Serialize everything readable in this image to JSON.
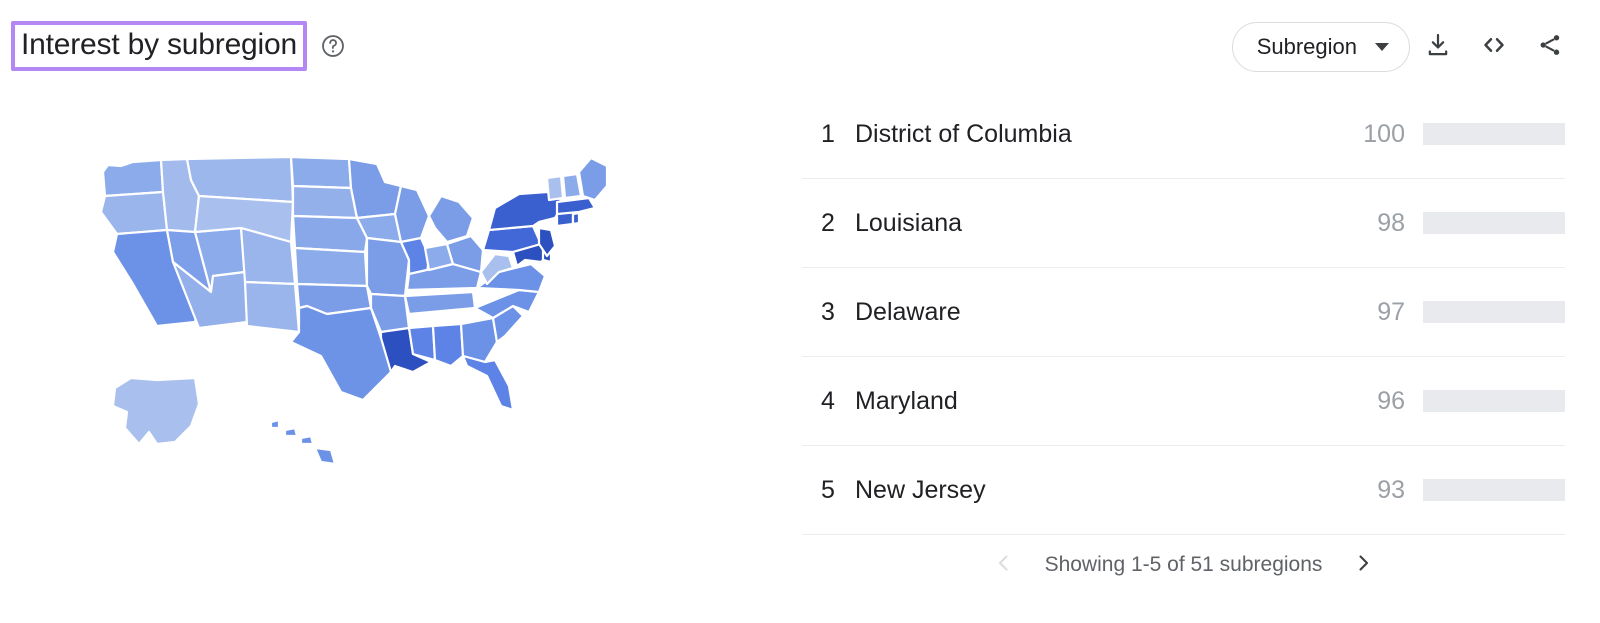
{
  "header": {
    "title": "Interest by subregion",
    "help_icon": "help-circle-icon",
    "title_highlight_color": "#b388f4"
  },
  "toolbar": {
    "region_select_value": "Subregion",
    "caret_icon": "chevron-down-icon",
    "download_icon": "download-icon",
    "embed_icon": "embed-code-icon",
    "share_icon": "share-icon"
  },
  "map": {
    "type": "choropleth",
    "region": "United States",
    "low_color": "#aac1ec",
    "high_color": "#2c50bf",
    "border_color": "#ffffff"
  },
  "list": {
    "bar_color": "#5c87e8",
    "track_color": "#e8eaed",
    "max_value": 100,
    "rows": [
      {
        "rank": "1",
        "name": "District of Columbia",
        "value": "100"
      },
      {
        "rank": "2",
        "name": "Louisiana",
        "value": "98"
      },
      {
        "rank": "3",
        "name": "Delaware",
        "value": "97"
      },
      {
        "rank": "4",
        "name": "Maryland",
        "value": "96"
      },
      {
        "rank": "5",
        "name": "New Jersey",
        "value": "93"
      }
    ]
  },
  "pagination": {
    "prev_icon": "chevron-left-icon",
    "next_icon": "chevron-right-icon",
    "status": "Showing 1-5 of 51 subregions"
  },
  "chart_data": {
    "type": "bar",
    "title": "Interest by subregion",
    "categories": [
      "District of Columbia",
      "Louisiana",
      "Delaware",
      "Maryland",
      "New Jersey"
    ],
    "values": [
      100,
      98,
      97,
      96,
      93
    ],
    "ranks": [
      1,
      2,
      3,
      4,
      5
    ],
    "xlabel": "",
    "ylabel": "",
    "ylim": [
      0,
      100
    ],
    "orientation": "horizontal",
    "grid": false,
    "legend": "none",
    "annotations": [
      "Showing 1-5 of 51 subregions"
    ]
  }
}
